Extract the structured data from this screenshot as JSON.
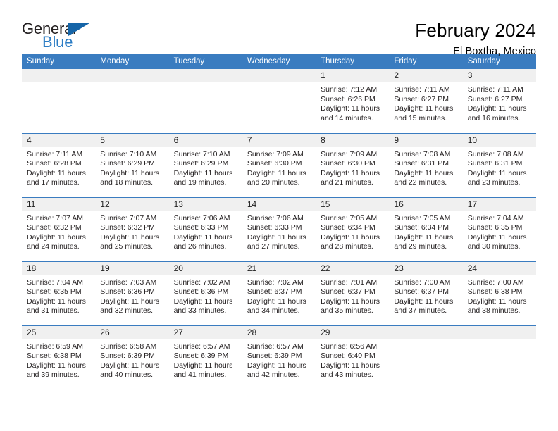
{
  "logo": {
    "word_top": "General",
    "word_bottom": "Blue",
    "triangle_icon": "triangle-icon",
    "accent_color": "#2b7cc4"
  },
  "header": {
    "title": "February 2024",
    "subtitle": "El Boxtha, Mexico"
  },
  "theme": {
    "header_blue": "#3a7cc0",
    "daynum_gray": "#f0f0f0"
  },
  "weekday_headers": [
    "Sunday",
    "Monday",
    "Tuesday",
    "Wednesday",
    "Thursday",
    "Friday",
    "Saturday"
  ],
  "labels": {
    "sunrise": "Sunrise:",
    "sunset": "Sunset:",
    "daylight": "Daylight:"
  },
  "weeks": [
    [
      {
        "day": "",
        "lines": []
      },
      {
        "day": "",
        "lines": []
      },
      {
        "day": "",
        "lines": []
      },
      {
        "day": "",
        "lines": []
      },
      {
        "day": "1",
        "lines": [
          "Sunrise: 7:12 AM",
          "Sunset: 6:26 PM",
          "Daylight: 11 hours",
          "and 14 minutes."
        ]
      },
      {
        "day": "2",
        "lines": [
          "Sunrise: 7:11 AM",
          "Sunset: 6:27 PM",
          "Daylight: 11 hours",
          "and 15 minutes."
        ]
      },
      {
        "day": "3",
        "lines": [
          "Sunrise: 7:11 AM",
          "Sunset: 6:27 PM",
          "Daylight: 11 hours",
          "and 16 minutes."
        ]
      }
    ],
    [
      {
        "day": "4",
        "lines": [
          "Sunrise: 7:11 AM",
          "Sunset: 6:28 PM",
          "Daylight: 11 hours",
          "and 17 minutes."
        ]
      },
      {
        "day": "5",
        "lines": [
          "Sunrise: 7:10 AM",
          "Sunset: 6:29 PM",
          "Daylight: 11 hours",
          "and 18 minutes."
        ]
      },
      {
        "day": "6",
        "lines": [
          "Sunrise: 7:10 AM",
          "Sunset: 6:29 PM",
          "Daylight: 11 hours",
          "and 19 minutes."
        ]
      },
      {
        "day": "7",
        "lines": [
          "Sunrise: 7:09 AM",
          "Sunset: 6:30 PM",
          "Daylight: 11 hours",
          "and 20 minutes."
        ]
      },
      {
        "day": "8",
        "lines": [
          "Sunrise: 7:09 AM",
          "Sunset: 6:30 PM",
          "Daylight: 11 hours",
          "and 21 minutes."
        ]
      },
      {
        "day": "9",
        "lines": [
          "Sunrise: 7:08 AM",
          "Sunset: 6:31 PM",
          "Daylight: 11 hours",
          "and 22 minutes."
        ]
      },
      {
        "day": "10",
        "lines": [
          "Sunrise: 7:08 AM",
          "Sunset: 6:31 PM",
          "Daylight: 11 hours",
          "and 23 minutes."
        ]
      }
    ],
    [
      {
        "day": "11",
        "lines": [
          "Sunrise: 7:07 AM",
          "Sunset: 6:32 PM",
          "Daylight: 11 hours",
          "and 24 minutes."
        ]
      },
      {
        "day": "12",
        "lines": [
          "Sunrise: 7:07 AM",
          "Sunset: 6:32 PM",
          "Daylight: 11 hours",
          "and 25 minutes."
        ]
      },
      {
        "day": "13",
        "lines": [
          "Sunrise: 7:06 AM",
          "Sunset: 6:33 PM",
          "Daylight: 11 hours",
          "and 26 minutes."
        ]
      },
      {
        "day": "14",
        "lines": [
          "Sunrise: 7:06 AM",
          "Sunset: 6:33 PM",
          "Daylight: 11 hours",
          "and 27 minutes."
        ]
      },
      {
        "day": "15",
        "lines": [
          "Sunrise: 7:05 AM",
          "Sunset: 6:34 PM",
          "Daylight: 11 hours",
          "and 28 minutes."
        ]
      },
      {
        "day": "16",
        "lines": [
          "Sunrise: 7:05 AM",
          "Sunset: 6:34 PM",
          "Daylight: 11 hours",
          "and 29 minutes."
        ]
      },
      {
        "day": "17",
        "lines": [
          "Sunrise: 7:04 AM",
          "Sunset: 6:35 PM",
          "Daylight: 11 hours",
          "and 30 minutes."
        ]
      }
    ],
    [
      {
        "day": "18",
        "lines": [
          "Sunrise: 7:04 AM",
          "Sunset: 6:35 PM",
          "Daylight: 11 hours",
          "and 31 minutes."
        ]
      },
      {
        "day": "19",
        "lines": [
          "Sunrise: 7:03 AM",
          "Sunset: 6:36 PM",
          "Daylight: 11 hours",
          "and 32 minutes."
        ]
      },
      {
        "day": "20",
        "lines": [
          "Sunrise: 7:02 AM",
          "Sunset: 6:36 PM",
          "Daylight: 11 hours",
          "and 33 minutes."
        ]
      },
      {
        "day": "21",
        "lines": [
          "Sunrise: 7:02 AM",
          "Sunset: 6:37 PM",
          "Daylight: 11 hours",
          "and 34 minutes."
        ]
      },
      {
        "day": "22",
        "lines": [
          "Sunrise: 7:01 AM",
          "Sunset: 6:37 PM",
          "Daylight: 11 hours",
          "and 35 minutes."
        ]
      },
      {
        "day": "23",
        "lines": [
          "Sunrise: 7:00 AM",
          "Sunset: 6:37 PM",
          "Daylight: 11 hours",
          "and 37 minutes."
        ]
      },
      {
        "day": "24",
        "lines": [
          "Sunrise: 7:00 AM",
          "Sunset: 6:38 PM",
          "Daylight: 11 hours",
          "and 38 minutes."
        ]
      }
    ],
    [
      {
        "day": "25",
        "lines": [
          "Sunrise: 6:59 AM",
          "Sunset: 6:38 PM",
          "Daylight: 11 hours",
          "and 39 minutes."
        ]
      },
      {
        "day": "26",
        "lines": [
          "Sunrise: 6:58 AM",
          "Sunset: 6:39 PM",
          "Daylight: 11 hours",
          "and 40 minutes."
        ]
      },
      {
        "day": "27",
        "lines": [
          "Sunrise: 6:57 AM",
          "Sunset: 6:39 PM",
          "Daylight: 11 hours",
          "and 41 minutes."
        ]
      },
      {
        "day": "28",
        "lines": [
          "Sunrise: 6:57 AM",
          "Sunset: 6:39 PM",
          "Daylight: 11 hours",
          "and 42 minutes."
        ]
      },
      {
        "day": "29",
        "lines": [
          "Sunrise: 6:56 AM",
          "Sunset: 6:40 PM",
          "Daylight: 11 hours",
          "and 43 minutes."
        ]
      },
      {
        "day": "",
        "lines": []
      },
      {
        "day": "",
        "lines": []
      }
    ]
  ]
}
